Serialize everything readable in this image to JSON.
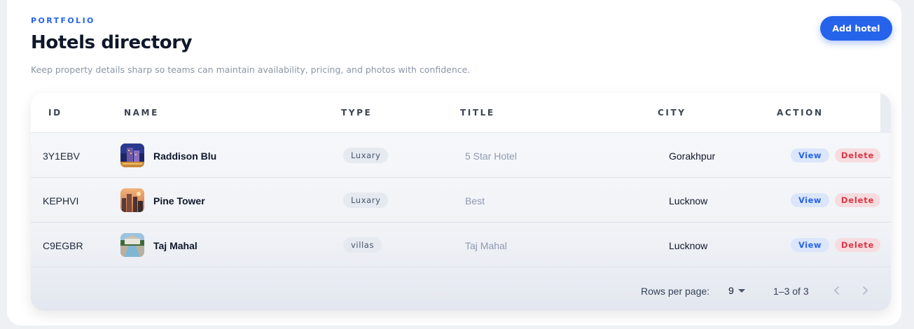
{
  "header": {
    "eyebrow": "PORTFOLIO",
    "title": "Hotels directory",
    "subtitle": "Keep property details sharp so teams can maintain availability, pricing, and photos with confidence.",
    "add_button_label": "Add hotel"
  },
  "table": {
    "columns": [
      "ID",
      "NAME",
      "TYPE",
      "TITLE",
      "CITY",
      "ACTION"
    ],
    "rows": [
      {
        "id": "3Y1EBV",
        "name": "Raddison Blu",
        "type": "Luxary",
        "title": "5 Star Hotel",
        "city": "Gorakhpur",
        "view_label": "View",
        "delete_label": "Delete",
        "thumb_icon": "hotel-night-photo"
      },
      {
        "id": "KEPHVI",
        "name": "Pine Tower",
        "type": "Luxary",
        "title": "Best",
        "city": "Lucknow",
        "view_label": "View",
        "delete_label": "Delete",
        "thumb_icon": "tower-sunset-photo"
      },
      {
        "id": "C9EGBR",
        "name": "Taj Mahal",
        "type": "villas",
        "title": "Taj Mahal",
        "city": "Lucknow",
        "view_label": "View",
        "delete_label": "Delete",
        "thumb_icon": "villa-pool-photo"
      }
    ]
  },
  "pagination": {
    "rows_per_page_label": "Rows per page:",
    "rows_per_page_value": "9",
    "range_label": "1–3 of 3"
  },
  "colors": {
    "accent": "#2563eb",
    "danger": "#dc3545",
    "background": "#eef0f4"
  }
}
